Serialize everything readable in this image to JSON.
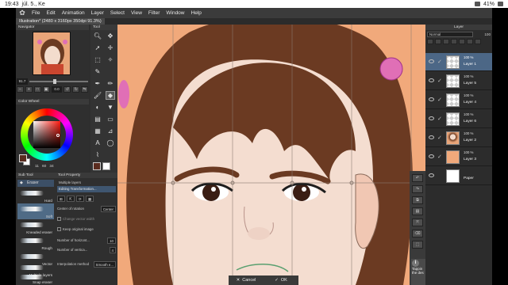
{
  "status": {
    "time": "19:43",
    "date": "júl. 5., Ke",
    "battery": "41%"
  },
  "menu": {
    "items": [
      "File",
      "Edit",
      "Animation",
      "Layer",
      "Select",
      "View",
      "Filter",
      "Window",
      "Help"
    ]
  },
  "document": {
    "tab_label": "Illustration* (2480 x 3160px 350dpi 91.3%)"
  },
  "navigator": {
    "title": "Navigator",
    "zoom": "91.7",
    "angle": "0.0"
  },
  "tool_panel": {
    "title": "Tool"
  },
  "color_wheel": {
    "title": "Color Wheel",
    "h": "11",
    "s": "60",
    "v": "34",
    "main_color": "#5a2c1f"
  },
  "sub_tool": {
    "title": "Sub Tool",
    "group": "Eraser",
    "items": [
      "Hard",
      "Soft",
      "Kneaded eraser",
      "Rough",
      "Vector",
      "Multiple layers",
      "Snap eraser"
    ],
    "selected": "Soft"
  },
  "tool_property": {
    "title": "Tool Property",
    "mode": "Multiple layers",
    "section": "Editing Transformation...",
    "center_label": "Center of rotation",
    "center_value": "Center",
    "change_vector": "Change vector width",
    "keep_original": "Keep original image",
    "num_horizontal": "Number of horizont...",
    "num_horizontal_value": "10",
    "num_vertical": "Number of vertica...",
    "num_vertical_value": "4",
    "interp_label": "Interpolation method",
    "interp_value": "Smooth e..."
  },
  "canvas": {
    "background": "#f1a97b",
    "hair": "#6b3a22"
  },
  "bottom_bar": {
    "cancel": "Cancel",
    "ok": "OK"
  },
  "layer_panel": {
    "title": "Layer",
    "blend_mode": "Normal",
    "opacity": "100",
    "layers": [
      {
        "pct": "100 %",
        "name": "Layer 1",
        "thumb": "transparent",
        "selected": true
      },
      {
        "pct": "100 %",
        "name": "Layer 5",
        "thumb": "transparent",
        "selected": false
      },
      {
        "pct": "100 %",
        "name": "Layer 4",
        "thumb": "transparent",
        "selected": false
      },
      {
        "pct": "100 %",
        "name": "Layer 6",
        "thumb": "transparent",
        "selected": false
      },
      {
        "pct": "100 %",
        "name": "Layer 2",
        "thumb": "face",
        "selected": false
      },
      {
        "pct": "100 %",
        "name": "Layer 3",
        "thumb": "skin",
        "selected": false
      },
      {
        "pct": "",
        "name": "Paper",
        "thumb": "paper",
        "selected": false
      }
    ]
  },
  "tooltip": {
    "text": "Tappin the des"
  }
}
